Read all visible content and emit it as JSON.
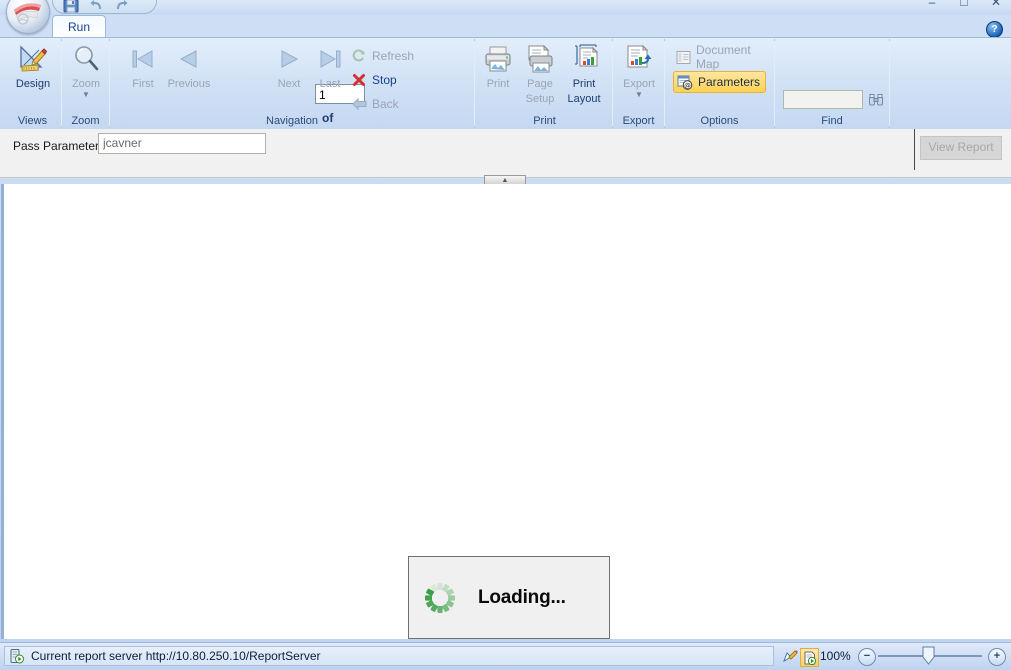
{
  "window": {
    "minimize_label": "–",
    "maximize_label": "□",
    "close_label": "✕",
    "help_label": "?"
  },
  "quick_access": {
    "save_icon": "save-icon",
    "undo_icon": "undo-icon",
    "redo_icon": "redo-icon"
  },
  "tabs": [
    {
      "label": "Run"
    }
  ],
  "ribbon": {
    "groups": [
      {
        "name": "views",
        "label": "Views",
        "buttons": [
          {
            "label": "Design",
            "icon": "design-icon",
            "enabled": true
          }
        ]
      },
      {
        "name": "zoom",
        "label": "Zoom",
        "buttons": [
          {
            "label": "Zoom",
            "icon": "magnifier-icon",
            "enabled": false,
            "has_dropdown": true,
            "dropdown_glyph": "▼"
          }
        ]
      },
      {
        "name": "navigation",
        "label": "Navigation",
        "buttons": [
          {
            "label": "First",
            "icon": "first-page-icon",
            "enabled": false
          },
          {
            "label": "Previous",
            "icon": "previous-page-icon",
            "enabled": false
          },
          {
            "label": "Next",
            "icon": "next-page-icon",
            "enabled": false
          },
          {
            "label": "Last",
            "icon": "last-page-icon",
            "enabled": false
          }
        ],
        "page_number_value": "1",
        "of_label": "of",
        "total_pages": "",
        "commands": [
          {
            "label": "Refresh",
            "icon": "refresh-icon",
            "enabled": false
          },
          {
            "label": "Stop",
            "icon": "stop-icon",
            "enabled": true
          },
          {
            "label": "Back",
            "icon": "back-arrow-icon",
            "enabled": false
          }
        ]
      },
      {
        "name": "print",
        "label": "Print",
        "buttons": [
          {
            "label": "Print",
            "icon": "printer-icon",
            "enabled": false
          },
          {
            "label": "Page Setup",
            "line1": "Page",
            "line2": "Setup",
            "icon": "page-setup-icon",
            "enabled": false
          },
          {
            "label": "Print Layout",
            "line1": "Print",
            "line2": "Layout",
            "icon": "print-layout-icon",
            "enabled": true
          }
        ]
      },
      {
        "name": "export",
        "label": "Export",
        "buttons": [
          {
            "label": "Export",
            "icon": "export-icon",
            "enabled": false,
            "has_dropdown": true,
            "dropdown_glyph": "▼"
          }
        ]
      },
      {
        "name": "options",
        "label": "Options",
        "items": [
          {
            "label": "Document Map",
            "icon": "document-map-icon",
            "enabled": false,
            "highlighted": false
          },
          {
            "label": "Parameters",
            "icon": "parameters-icon",
            "enabled": true,
            "highlighted": true
          }
        ]
      },
      {
        "name": "find",
        "label": "Find",
        "search_value": "",
        "search_placeholder": "",
        "find_icon": "binoculars-icon"
      }
    ]
  },
  "parameter_bar": {
    "label": "Pass Parameter",
    "value": "jcavner",
    "placeholder": "",
    "view_report_label": "View Report",
    "view_report_enabled": false,
    "collapse_glyph": "▲"
  },
  "report_area": {
    "loading_text": "Loading...",
    "spinner_icon": "loading-spinner-icon"
  },
  "status_bar": {
    "server_icon": "report-server-icon",
    "server_text": "Current report server http://10.80.250.10/ReportServer",
    "icon1": "design-mode-icon",
    "icon2": "run-mode-icon",
    "zoom_level": "100%",
    "zoom_out_glyph": "−",
    "zoom_in_glyph": "+"
  },
  "colors": {
    "ribbon_top": "#e3eefb",
    "ribbon_bottom": "#c4d8f1",
    "accent_text": "#15428b",
    "highlight_yellow": "#ffd155",
    "spinner_green": "#3a9e47",
    "disabled_gray": "#9aa5b3"
  }
}
